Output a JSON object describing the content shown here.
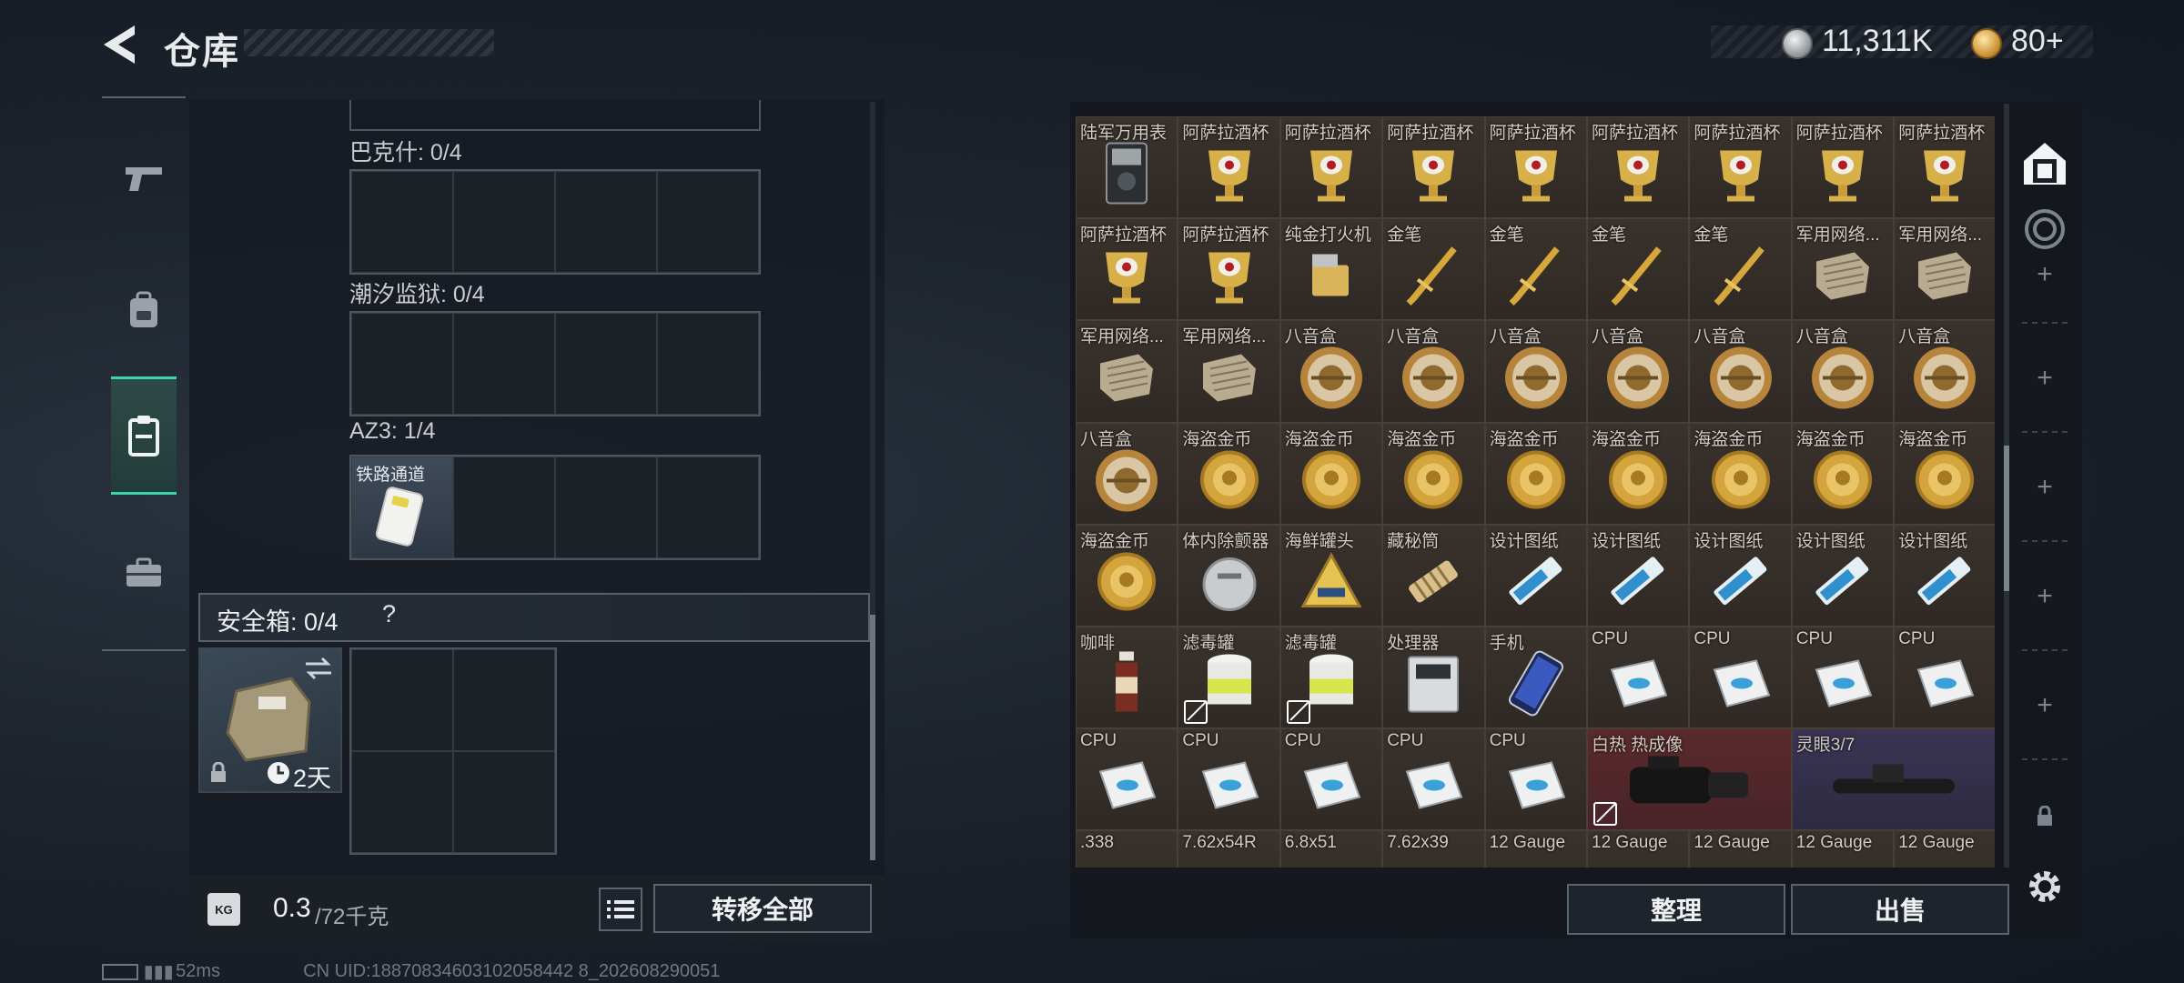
{
  "header": {
    "title": "仓库",
    "currency_silver": "11,311K",
    "currency_gold": "80+"
  },
  "colors": {
    "accent": "#3fd3a8",
    "tile_bg": "#3a322c",
    "tile_red": "#5a2a2c",
    "tile_purple": "#3a3452",
    "panel": "#161b22"
  },
  "nav": {
    "items": [
      {
        "name": "pistol-icon",
        "active": false
      },
      {
        "name": "backpack-icon",
        "active": false
      },
      {
        "name": "clipboard-icon",
        "active": true
      },
      {
        "name": "toolbox-icon",
        "active": false
      }
    ]
  },
  "left": {
    "cat1": "巴克什: 0/4",
    "cat2": "潮汐监狱: 0/4",
    "cat3": "AZ3: 1/4",
    "cat3_item": "铁路通道",
    "safe_label": "安全箱: 0/4",
    "safe_help": "?",
    "safe_time": "2天",
    "weight_value": "0.3",
    "weight_max": "/72千克",
    "transfer_all": "转移全部"
  },
  "right": {
    "sort_button": "整理",
    "sell_button": "出售",
    "rows": [
      [
        "陆军万用表",
        "阿萨拉酒杯",
        "阿萨拉酒杯",
        "阿萨拉酒杯",
        "阿萨拉酒杯",
        "阿萨拉酒杯",
        "阿萨拉酒杯",
        "阿萨拉酒杯",
        "阿萨拉酒杯"
      ],
      [
        "阿萨拉酒杯",
        "阿萨拉酒杯",
        "纯金打火机",
        "金笔",
        "金笔",
        "金笔",
        "金笔",
        "军用网络...",
        "军用网络..."
      ],
      [
        "军用网络...",
        "军用网络...",
        "八音盒",
        "八音盒",
        "八音盒",
        "八音盒",
        "八音盒",
        "八音盒",
        "八音盒"
      ],
      [
        "八音盒",
        "海盗金币",
        "海盗金币",
        "海盗金币",
        "海盗金币",
        "海盗金币",
        "海盗金币",
        "海盗金币",
        "海盗金币"
      ],
      [
        "海盗金币",
        "体内除颤器",
        "海鲜罐头",
        "藏秘筒",
        "设计图纸",
        "设计图纸",
        "设计图纸",
        "设计图纸",
        "设计图纸"
      ],
      [
        "咖啡",
        "滤毒罐",
        "滤毒罐",
        "处理器",
        "手机",
        "CPU",
        "CPU",
        "CPU",
        "CPU"
      ],
      [
        "CPU",
        "CPU",
        "CPU",
        "CPU",
        "CPU",
        "白热 热成像",
        "",
        "灵眼3/7",
        ""
      ],
      [
        ".338",
        "7.62x54R",
        "6.8x51",
        "7.62x39",
        "12 Gauge",
        "12 Gauge",
        "12 Gauge",
        "12 Gauge",
        "12 Gauge"
      ]
    ],
    "icons": [
      [
        "multimeter-icon",
        "goblet-icon",
        "goblet-icon",
        "goblet-icon",
        "goblet-icon",
        "goblet-icon",
        "goblet-icon",
        "goblet-icon",
        "goblet-icon"
      ],
      [
        "goblet-icon",
        "goblet-icon",
        "lighter-icon",
        "gold-pen-icon",
        "gold-pen-icon",
        "gold-pen-icon",
        "gold-pen-icon",
        "network-module-icon",
        "network-module-icon"
      ],
      [
        "network-module-icon",
        "network-module-icon",
        "music-box-icon",
        "music-box-icon",
        "music-box-icon",
        "music-box-icon",
        "music-box-icon",
        "music-box-icon",
        "music-box-icon"
      ],
      [
        "music-box-icon",
        "gold-coin-icon",
        "gold-coin-icon",
        "gold-coin-icon",
        "gold-coin-icon",
        "gold-coin-icon",
        "gold-coin-icon",
        "gold-coin-icon",
        "gold-coin-icon"
      ],
      [
        "gold-coin-icon",
        "defibrillator-icon",
        "can-icon",
        "cryptex-icon",
        "blueprint-icon",
        "blueprint-icon",
        "blueprint-icon",
        "blueprint-icon",
        "blueprint-icon"
      ],
      [
        "coffee-icon",
        "filter-canister-icon",
        "filter-canister-icon",
        "processor-box-icon",
        "phone-icon",
        "cpu-icon",
        "cpu-icon",
        "cpu-icon",
        "cpu-icon"
      ],
      [
        "cpu-icon",
        "cpu-icon",
        "cpu-icon",
        "cpu-icon",
        "cpu-icon",
        "thermal-scope-icon",
        "",
        "scope-icon",
        ""
      ],
      [
        "ammo-icon",
        "ammo-icon",
        "ammo-icon",
        "ammo-icon",
        "ammo-icon",
        "ammo-icon",
        "ammo-icon",
        "ammo-icon",
        "ammo-icon"
      ]
    ]
  },
  "status": {
    "ping": "52ms",
    "uid": "CN UID:18870834603102058442 8_202608290051"
  }
}
